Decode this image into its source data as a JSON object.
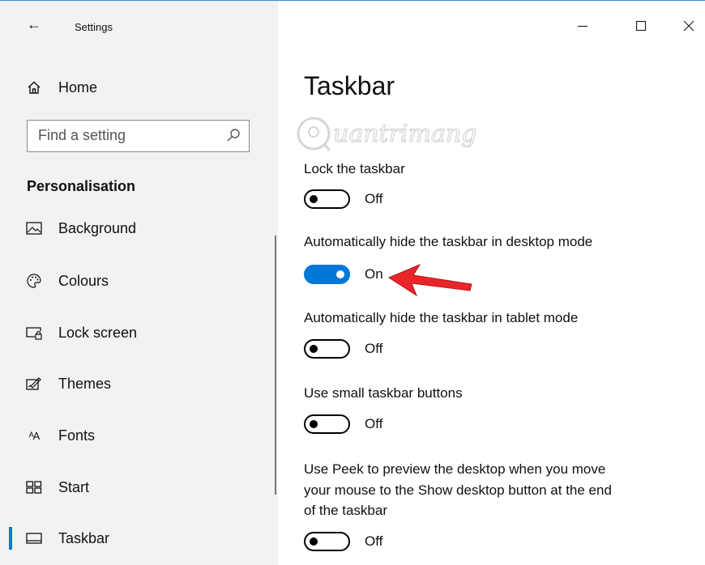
{
  "window": {
    "app_title": "Settings",
    "controls": {
      "minimize": "–",
      "maximize": "☐",
      "close": "✕"
    }
  },
  "sidebar": {
    "back_icon": "back-arrow-icon",
    "home": {
      "label": "Home",
      "icon": "home-icon"
    },
    "search": {
      "placeholder": "Find a setting",
      "icon": "search-icon"
    },
    "section": "Personalisation",
    "items": [
      {
        "label": "Background",
        "icon": "background-icon"
      },
      {
        "label": "Colours",
        "icon": "palette-icon"
      },
      {
        "label": "Lock screen",
        "icon": "lock-screen-icon"
      },
      {
        "label": "Themes",
        "icon": "themes-icon"
      },
      {
        "label": "Fonts",
        "icon": "fonts-icon",
        "glyph": "ᴬA"
      },
      {
        "label": "Start",
        "icon": "start-icon"
      },
      {
        "label": "Taskbar",
        "icon": "taskbar-icon",
        "active": true
      }
    ]
  },
  "main": {
    "title": "Taskbar",
    "watermark": "Quantrimang",
    "options": [
      {
        "label": "Lock the taskbar",
        "state": "Off",
        "on": false
      },
      {
        "label": "Automatically hide the taskbar in desktop mode",
        "state": "On",
        "on": true
      },
      {
        "label": "Automatically hide the taskbar in tablet mode",
        "state": "Off",
        "on": false
      },
      {
        "label": "Use small taskbar buttons",
        "state": "Off",
        "on": false
      },
      {
        "label_lines": [
          "Use Peek to preview the desktop when you move",
          "your mouse to the Show desktop button at the end",
          "of the taskbar"
        ],
        "state": "Off",
        "on": false
      }
    ]
  },
  "colors": {
    "accent": "#0078d7",
    "arrow": "#e8262a",
    "sidebar_bg": "#f2f2f2"
  }
}
